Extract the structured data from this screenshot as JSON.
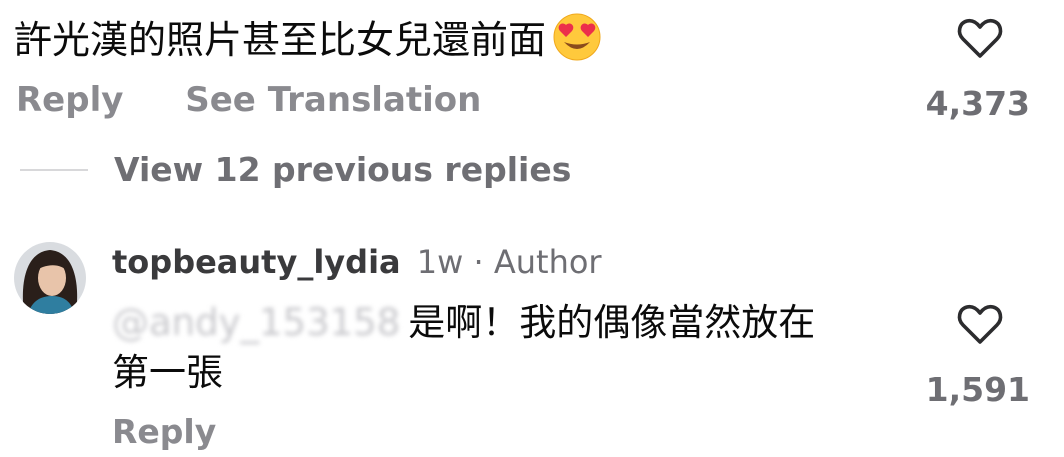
{
  "comment": {
    "text": "許光漢的照片甚至比女兒還前面",
    "emoji_icon": "heart-eyes-emoji",
    "actions": {
      "reply_label": "Reply",
      "translate_label": "See Translation"
    },
    "like_count": "4,373"
  },
  "replies": {
    "view_previous_label": "View 12 previous replies"
  },
  "reply": {
    "username": "topbeauty_lydia",
    "time": "1w",
    "separator": "·",
    "badge": "Author",
    "mention": "@andy_153158",
    "text_line1": "是啊！我的偶像當然放在",
    "text_line2": "第一張",
    "reply_label": "Reply",
    "like_count": "1,591"
  },
  "colors": {
    "text": "#0b0b0b",
    "secondary": "#6e6e73",
    "divider": "#d8d8da"
  }
}
